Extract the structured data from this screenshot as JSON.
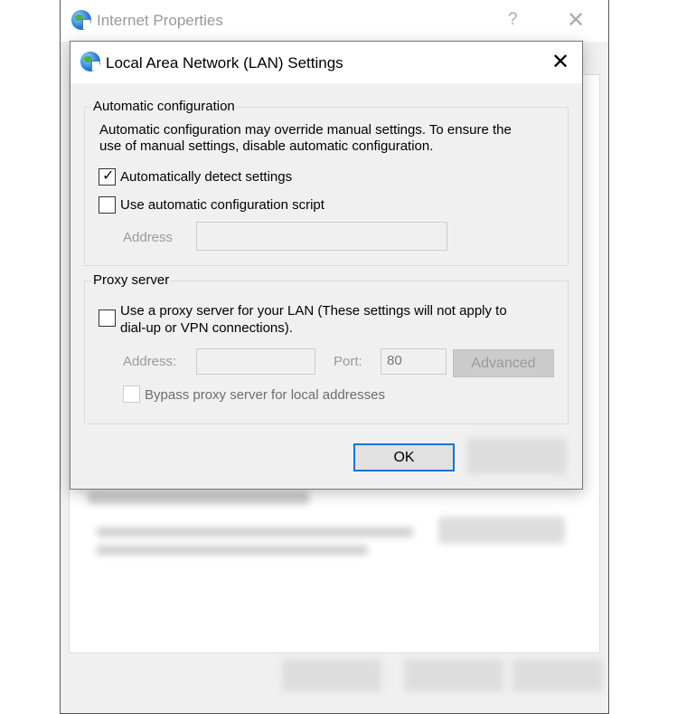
{
  "outer_window": {
    "title": "Internet Properties",
    "help": "?",
    "close": "✕"
  },
  "lan_dialog": {
    "title": "Local Area Network (LAN) Settings",
    "close": "✕",
    "auto_config": {
      "legend": "Automatic configuration",
      "description_line1": "Automatic configuration may override manual settings.  To ensure the",
      "description_line2": "use of manual settings, disable automatic configuration.",
      "auto_detect": {
        "label": "Automatically detect settings",
        "checked": true
      },
      "auto_script": {
        "label": "Use automatic configuration script",
        "checked": false
      },
      "address_label": "Address",
      "address_value": ""
    },
    "proxy": {
      "legend": "Proxy server",
      "use_proxy_line1": "Use a proxy server for your LAN (These settings will not apply to",
      "use_proxy_line2": "dial-up or VPN connections).",
      "use_proxy_checked": false,
      "address_label": "Address:",
      "address_value": "",
      "port_label": "Port:",
      "port_value": "80",
      "advanced_label": "Advanced",
      "bypass_label": "Bypass proxy server for local addresses",
      "bypass_checked": false
    },
    "ok_label": "OK"
  }
}
